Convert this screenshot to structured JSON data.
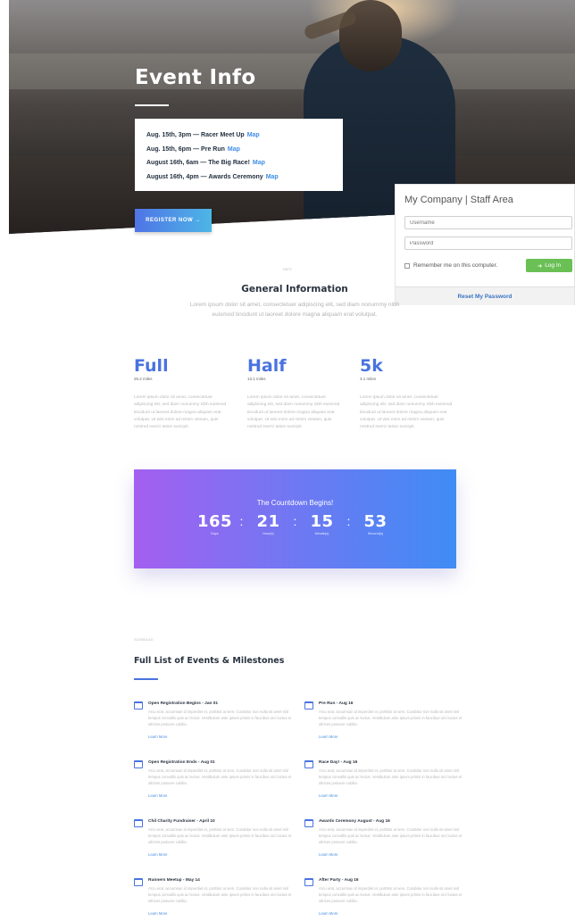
{
  "hero": {
    "title": "Event Info",
    "info_lines": [
      {
        "text": "Aug. 15th, 3pm — Racer Meet Up",
        "link": "Map"
      },
      {
        "text": "Aug. 15th, 6pm — Pre Run",
        "link": "Map"
      },
      {
        "text": "August 16th, 6am — The Big Race!",
        "link": "Map"
      },
      {
        "text": "August 16th, 4pm — Awards Ceremony",
        "link": "Map"
      }
    ],
    "register_label": "REGISTER NOW →"
  },
  "staff": {
    "title": "My Company | Staff Area",
    "username_placeholder": "Username",
    "password_placeholder": "Password",
    "remember_label": "Remember me on this computer.",
    "login_label": "Log In",
    "reset_label": "Reset My Password"
  },
  "general": {
    "eyebrow": "INFO",
    "title": "General Information",
    "text": "Lorem ipsum dolor sit amet, consectetuer adipiscing elit, sed diam nonummy nibh euismod tincidunt ut laoreet dolore magna aliquam erat volutpat."
  },
  "distances": [
    {
      "head": "Full",
      "sub": "26.2 miles",
      "text": "Lorem ipsum dolor sit amet, consectetuer adipiscing elit, sed diam nonummy nibh euismod tincidunt ut laoreet dolore magna aliquam erat volutpat. Ut wisi enim ad minim veniam, quis nostrud exerci tation suscipit."
    },
    {
      "head": "Half",
      "sub": "13.1 miles",
      "text": "Lorem ipsum dolor sit amet, consectetuer adipiscing elit, sed diam nonummy nibh euismod tincidunt ut laoreet dolore magna aliquam erat volutpat. Ut wisi enim ad minim veniam, quis nostrud exerci tation suscipit."
    },
    {
      "head": "5k",
      "sub": "3.1 miles",
      "text": "Lorem ipsum dolor sit amet, consectetuer adipiscing elit, sed diam nonummy nibh euismod tincidunt ut laoreet dolore magna aliquam erat volutpat. Ut wisi enim ad minim veniam, quis nostrud exerci tation suscipit."
    }
  ],
  "countdown": {
    "title": "The Countdown Begins!",
    "days": "165",
    "days_label": "Days",
    "hours": "21",
    "hours_label": "Hour(s)",
    "minutes": "15",
    "minutes_label": "Minute(s)",
    "seconds": "53",
    "seconds_label": "Second(s)",
    "separator": ":"
  },
  "schedule": {
    "eyebrow": "SCHEDULE",
    "title": "Full List of Events & Milestones",
    "events": [
      {
        "title": "Open Registration Begins - Jan 01",
        "text": "Arcu erat, accumsan id imperdiet et, porttitor at sem. Curabitur non nulla sit amet nisl tempus convallis quis ac lectus. Vestibulum ante ipsum primis in faucibus orci luctus et ultrices posuere cubilia.",
        "link": "Learn More"
      },
      {
        "title": "Pre Run - Aug 16",
        "text": "Arcu erat, accumsan id imperdiet et, porttitor at sem. Curabitur non nulla sit amet nisl tempus convallis quis ac lectus. Vestibulum ante ipsum primis in faucibus orci luctus et ultrices posuere cubilia.",
        "link": "Learn More"
      },
      {
        "title": "Open Registration Ends - Aug 01",
        "text": "Arcu erat, accumsan id imperdiet et, porttitor at sem. Curabitur non nulla sit amet nisl tempus convallis quis ac lectus. Vestibulum ante ipsum primis in faucibus orci luctus et ultrices posuere cubilia.",
        "link": "Learn More"
      },
      {
        "title": "Race Day! - Aug 16",
        "text": "Arcu erat, accumsan id imperdiet et, porttitor at sem. Curabitur non nulla sit amet nisl tempus convallis quis ac lectus. Vestibulum ante ipsum primis in faucibus orci luctus et ultrices posuere cubilia.",
        "link": "Learn More"
      },
      {
        "title": "Chil Charity Fundraiser - April 10",
        "text": "Arcu erat, accumsan id imperdiet et, porttitor at sem. Curabitur non nulla sit amet nisl tempus convallis quis ac lectus. Vestibulum ante ipsum primis in faucibus orci luctus et ultrices posuere cubilia.",
        "link": "Learn More"
      },
      {
        "title": "Awards Ceremony August - Aug 16",
        "text": "Arcu erat, accumsan id imperdiet et, porttitor at sem. Curabitur non nulla sit amet nisl tempus convallis quis ac lectus. Vestibulum ante ipsum primis in faucibus orci luctus et ultrices posuere cubilia.",
        "link": "Learn More"
      },
      {
        "title": "Runners Meetup - May 14",
        "text": "Arcu erat, accumsan id imperdiet et, porttitor at sem. Curabitur non nulla sit amet nisl tempus convallis quis ac lectus. Vestibulum ante ipsum primis in faucibus orci luctus et ultrices posuere cubilia.",
        "link": "Learn More"
      },
      {
        "title": "After Party - Aug 16",
        "text": "Arcu erat, accumsan id imperdiet et, porttitor at sem. Curabitur non nulla sit amet nisl tempus convallis quis ac lectus. Vestibulum ante ipsum primis in faucibus orci luctus et ultrices posuere cubilia.",
        "link": "Learn More"
      }
    ]
  },
  "colors": {
    "accent_blue": "#4a73e0",
    "link_blue": "#3f8fe8",
    "login_green": "#6abf55",
    "countdown_start": "#a45ff0",
    "countdown_end": "#3f8cf5"
  }
}
